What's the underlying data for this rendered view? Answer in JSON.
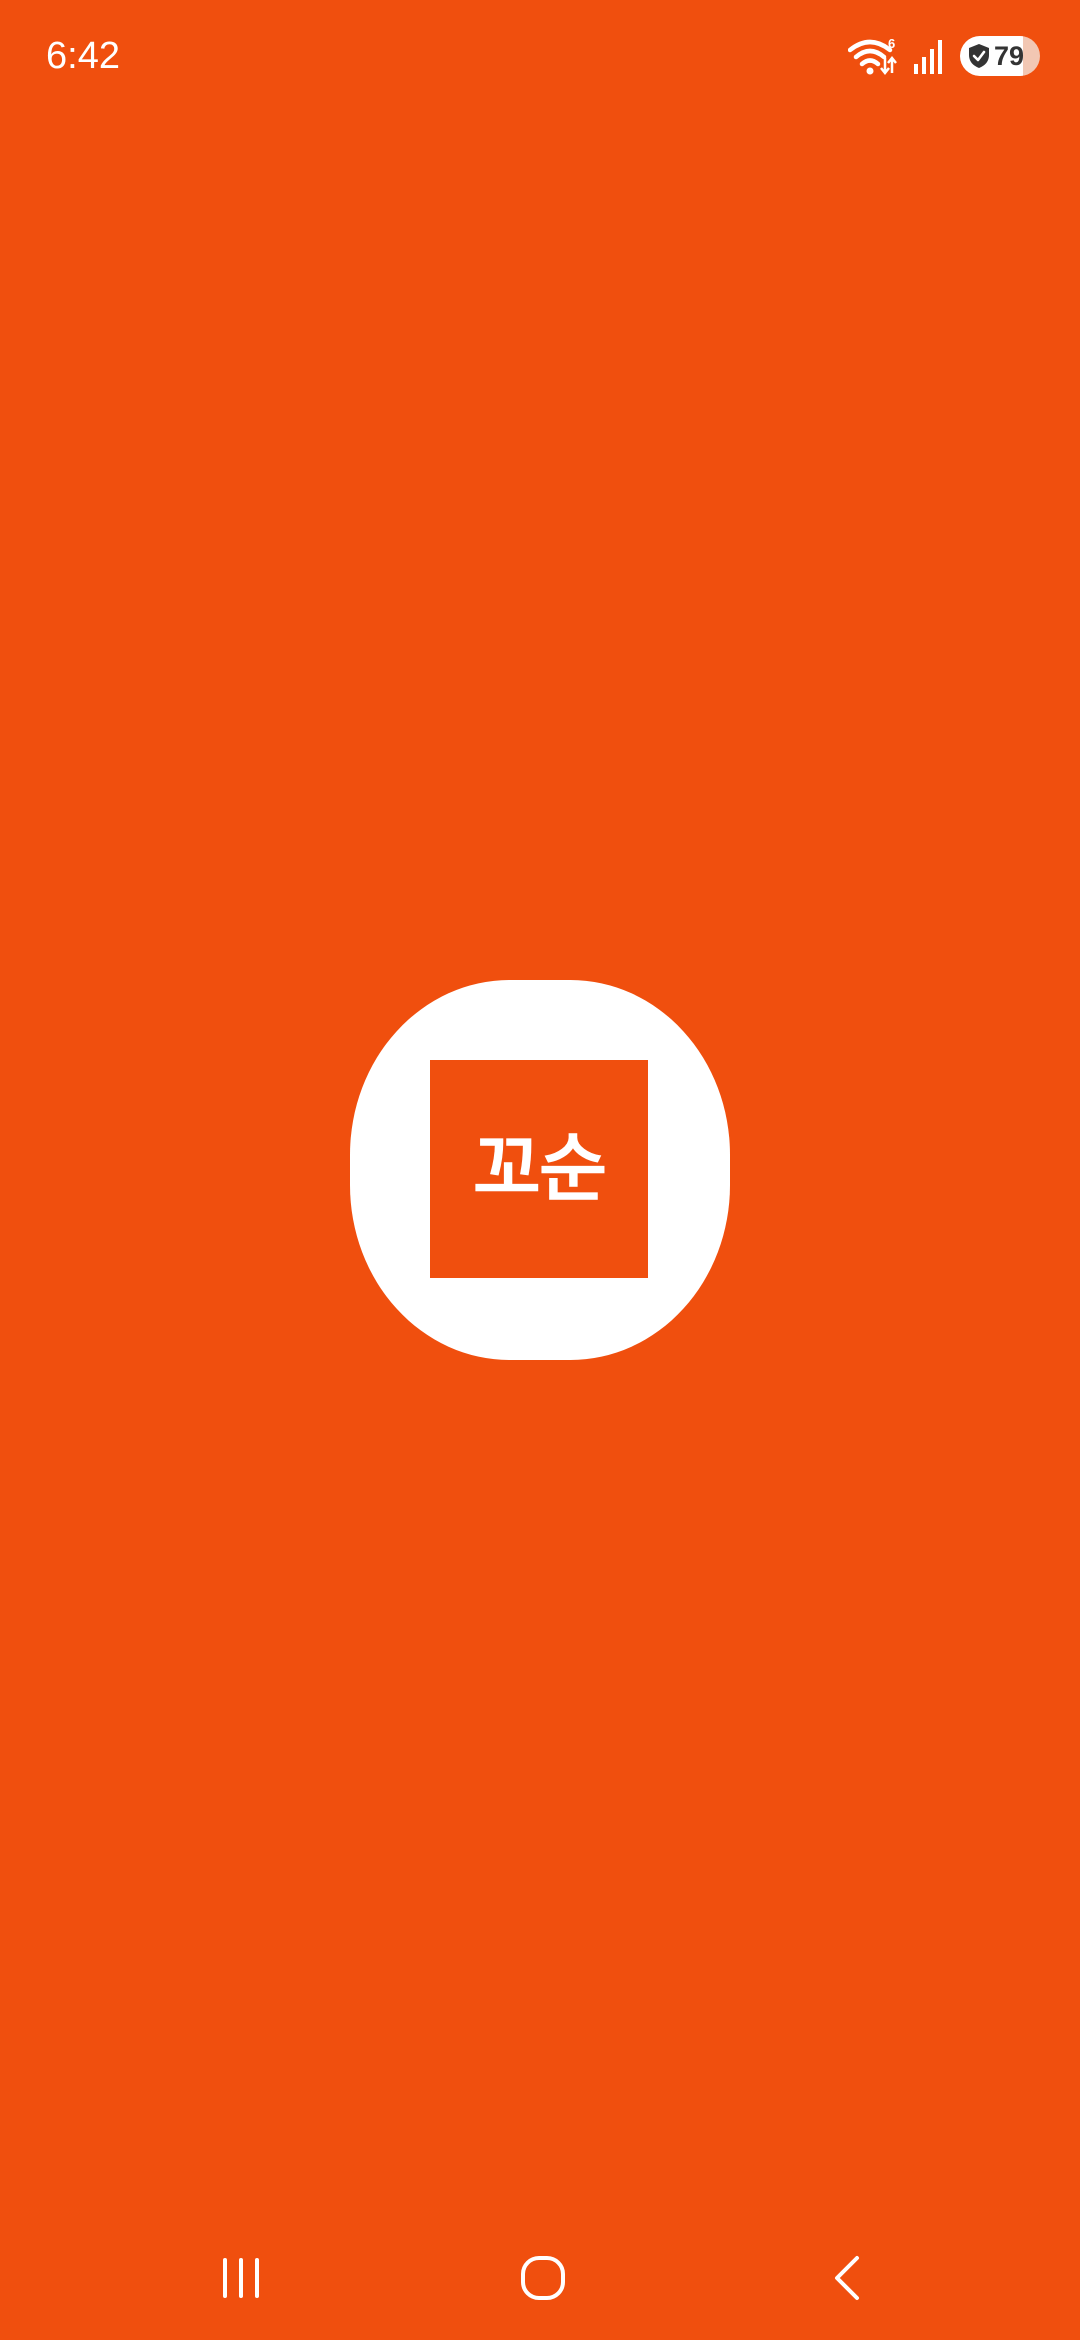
{
  "theme": {
    "background": "#F04F0E",
    "foreground": "#FFFFFF",
    "logo_accent": "#F04F0E"
  },
  "status_bar": {
    "time": "6:42",
    "wifi_badge": "6",
    "battery_level": "79",
    "battery_fraction": 0.79,
    "icons": [
      "wifi-icon",
      "signal-icon",
      "shield-icon",
      "battery-icon"
    ]
  },
  "splash": {
    "logo_text": "꼬순",
    "logo_icon": "app-logo-icon"
  },
  "nav_bar": {
    "buttons": [
      "recent-apps-icon",
      "home-icon",
      "back-icon"
    ]
  }
}
